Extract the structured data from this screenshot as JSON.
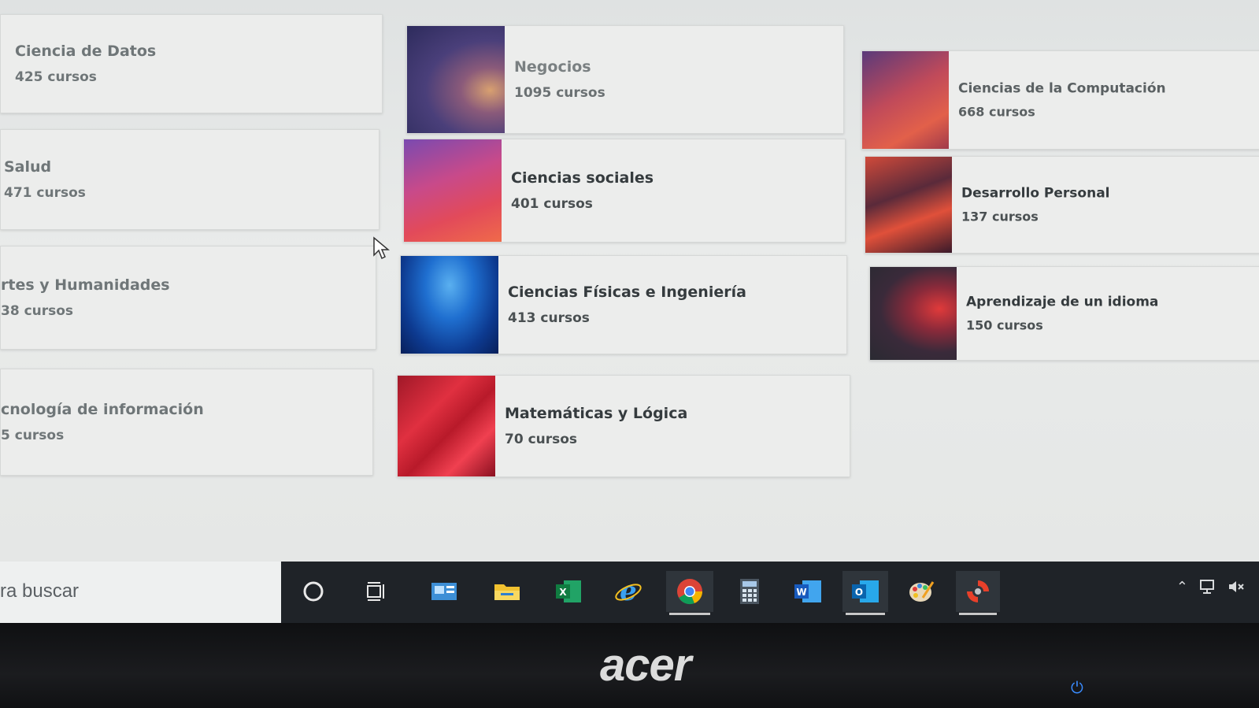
{
  "categories": {
    "left_column": [
      {
        "title": "Ciencia de Datos",
        "count": "425 cursos"
      },
      {
        "title": "Salud",
        "count": "471 cursos"
      },
      {
        "title": "rtes y Humanidades",
        "count": "38 cursos"
      },
      {
        "title": "cnología de información",
        "count": "5 cursos"
      }
    ],
    "middle_column": [
      {
        "title": "Negocios",
        "count": "1095 cursos"
      },
      {
        "title": "Ciencias sociales",
        "count": "401 cursos"
      },
      {
        "title": "Ciencias Físicas e Ingeniería",
        "count": "413 cursos"
      },
      {
        "title": "Matemáticas y Lógica",
        "count": "70 cursos"
      }
    ],
    "right_column": [
      {
        "title": "Ciencias de la Computación",
        "count": "668 cursos"
      },
      {
        "title": "Desarrollo Personal",
        "count": "137 cursos"
      },
      {
        "title": "Aprendizaje de un idioma",
        "count": "150 cursos"
      }
    ]
  },
  "taskbar": {
    "search_placeholder": "ra buscar",
    "apps": [
      {
        "name": "cortana-icon"
      },
      {
        "name": "task-view-icon"
      },
      {
        "name": "news-icon"
      },
      {
        "name": "file-explorer-icon"
      },
      {
        "name": "excel-icon"
      },
      {
        "name": "internet-explorer-icon"
      },
      {
        "name": "chrome-icon",
        "active": true
      },
      {
        "name": "calculator-icon"
      },
      {
        "name": "word-icon"
      },
      {
        "name": "outlook-icon"
      },
      {
        "name": "paint-icon"
      },
      {
        "name": "app-icon"
      }
    ],
    "tray": [
      "chevron-up-icon",
      "network-icon",
      "volume-muted-icon"
    ]
  },
  "monitor": {
    "brand": "acer"
  }
}
